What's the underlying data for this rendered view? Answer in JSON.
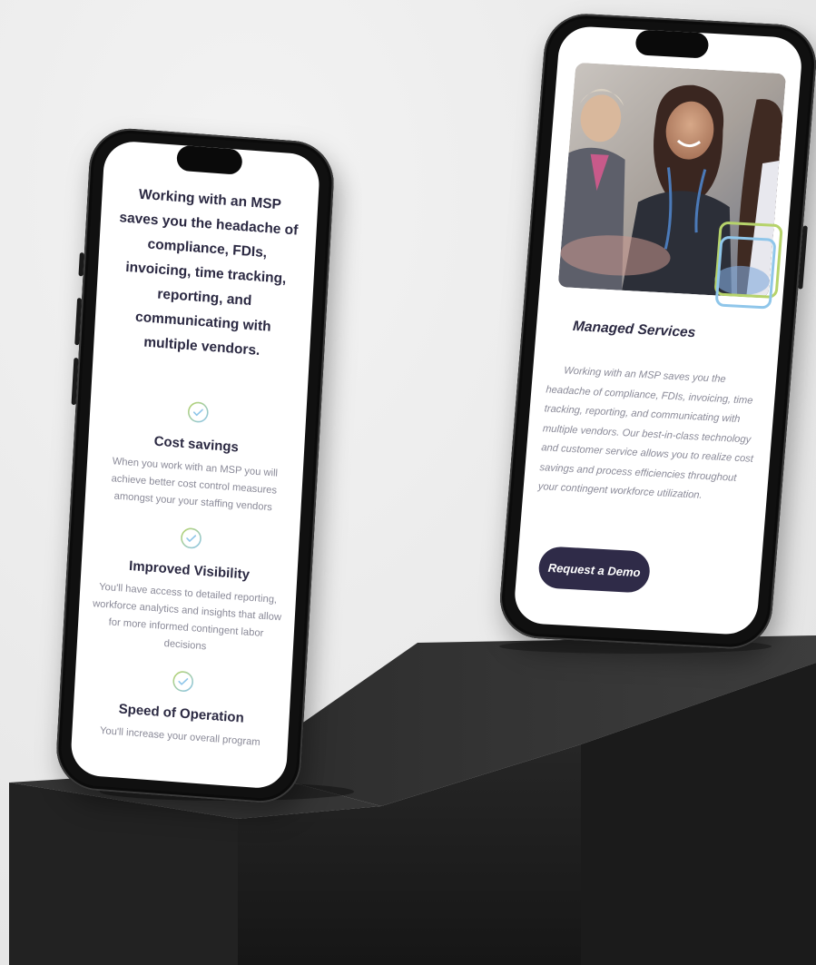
{
  "left_phone": {
    "intro": "Working with an MSP saves you the headache of compliance, FDIs, invoicing, time tracking, reporting, and communicating with multiple vendors.",
    "features": [
      {
        "icon": "check-circle-icon",
        "title": "Cost savings",
        "text": "When you work with an MSP you will achieve better cost control measures amongst your your staffing vendors"
      },
      {
        "icon": "check-circle-icon",
        "title": "Improved Visibility",
        "text": "You'll have access to detailed reporting, workforce analytics and insights that allow for more informed contingent labor decisions"
      },
      {
        "icon": "check-circle-icon",
        "title": "Speed of Operation",
        "text": "You'll increase your overall program"
      }
    ]
  },
  "right_phone": {
    "photo": "professional-team-photo",
    "title": "Managed Services",
    "text": "Working with an MSP saves you the headache of compliance, FDIs, invoicing, time tracking, reporting, and communicating with multiple vendors. Our best-in-class technology and customer service allows you to realize cost savings and process efficiencies throughout your contingent workforce utilization.",
    "cta_label": "Request a Demo"
  },
  "colors": {
    "heading": "#2b2942",
    "body_text": "#8a8a98",
    "button_bg": "#2f2b48",
    "accent_green": "#b6d36b",
    "accent_blue": "#8fc6ea",
    "pedestal": "#1c1c1c"
  }
}
